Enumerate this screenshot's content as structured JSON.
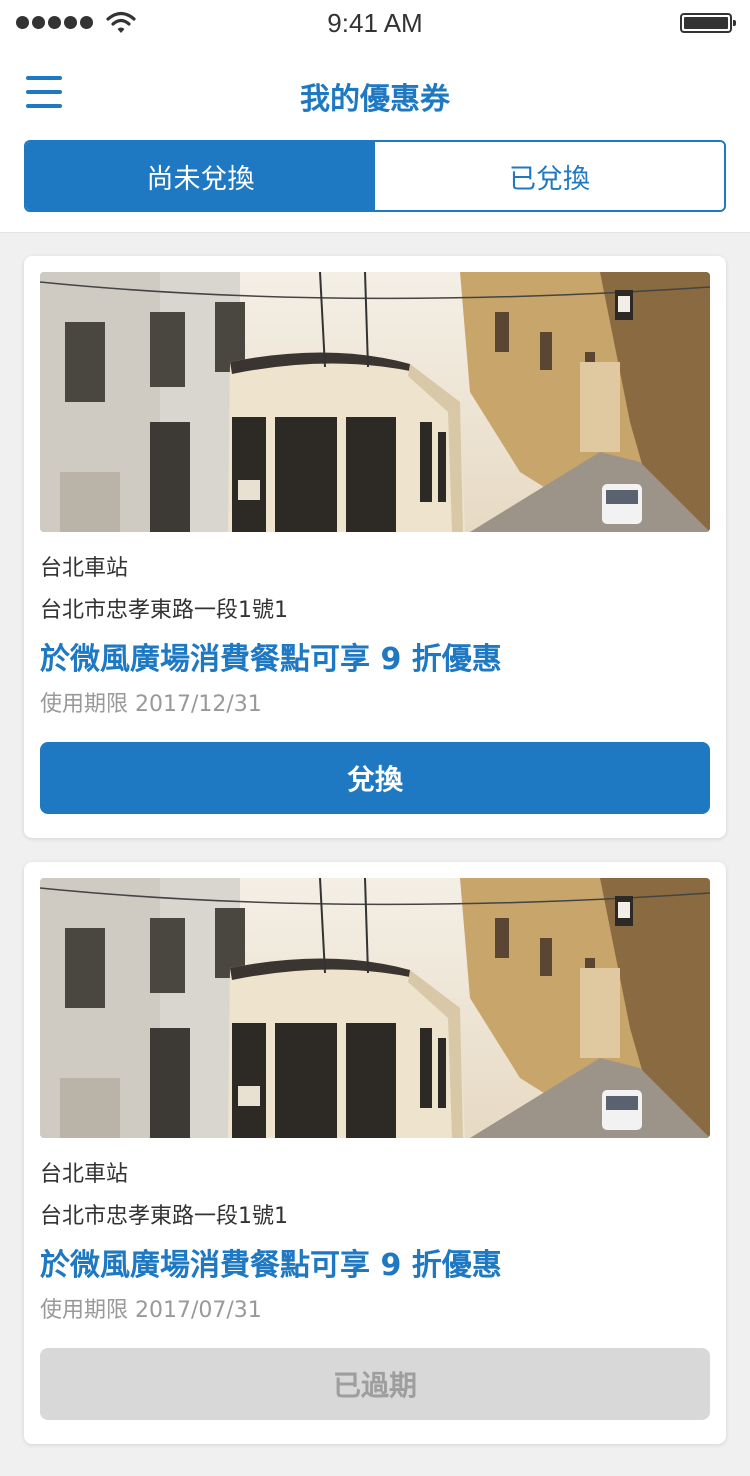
{
  "status_bar": {
    "time": "9:41 AM"
  },
  "header": {
    "title": "我的優惠券",
    "menu_icon": "hamburger-menu-icon"
  },
  "tabs": [
    {
      "label": "尚未兌換",
      "active": true
    },
    {
      "label": "已兌換",
      "active": false
    }
  ],
  "coupons": [
    {
      "store": "台北車站",
      "address": "台北市忠孝東路一段1號1",
      "offer": "於微風廣場消費餐點可享 9 折優惠",
      "validity": "使用期限 2017/12/31",
      "action_label": "兌換",
      "state": "redeemable"
    },
    {
      "store": "台北車站",
      "address": "台北市忠孝東路一段1號1",
      "offer": "於微風廣場消費餐點可享 9 折優惠",
      "validity": "使用期限 2017/07/31",
      "action_label": "已過期",
      "state": "expired"
    }
  ],
  "colors": {
    "accent": "#1e78c2",
    "expired_button": "#d8d8d8",
    "expired_text": "#9e9e9e"
  }
}
